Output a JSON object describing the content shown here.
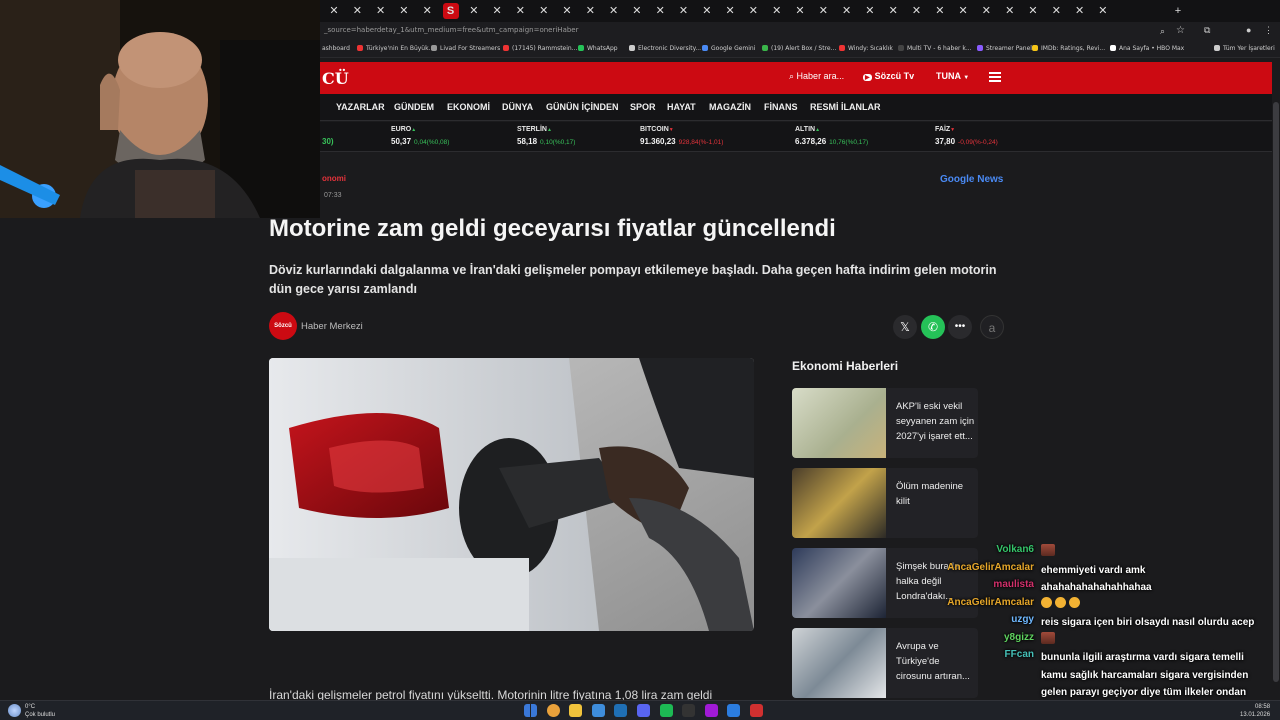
{
  "browser": {
    "url": "_source=haberdetay_1&utm_medium=free&utm_campaign=oneriHaber",
    "bookmarks": [
      "ashboard",
      "Türkiye'nin En Büyük...",
      "Livad For Streamers",
      "(17145) Rammstein...",
      "WhatsApp",
      "Electronic Diversity...",
      "Google Gemini",
      "(19) Alert Box / Stre...",
      "Windy: Sıcaklık",
      "Multi TV - 6 haber k...",
      "Streamer Panel",
      "IMDb: Ratings, Revi...",
      "Ana Sayfa • HBO Max",
      "Tüm Yer İşaretleri"
    ]
  },
  "site": {
    "logo": "CÜ",
    "search_placeholder": "Haber ara...",
    "tv_label": "Sözcü Tv",
    "user_label": "TUNA",
    "nav": [
      "YAZARLAR",
      "GÜNDEM",
      "EKONOMİ",
      "DÜNYA",
      "GÜNÜN İÇİNDEN",
      "SPOR",
      "HAYAT",
      "MAGAZİN",
      "FİNANS",
      "RESMİ İLANLAR"
    ]
  },
  "ticker": [
    {
      "name": "EURO",
      "value": "50,37",
      "change": "0,04(%0,08)",
      "dir": "up"
    },
    {
      "name": "STERLİN",
      "value": "58,18",
      "change": "0,10(%0,17)",
      "dir": "up"
    },
    {
      "name": "BITCOIN",
      "value": "91.360,23",
      "change": "928,84(%-1,01)",
      "dir": "down"
    },
    {
      "name": "ALTIN",
      "value": "6.378,26",
      "change": "10,76(%0,17)",
      "dir": "up"
    },
    {
      "name": "FAİZ",
      "value": "37,80",
      "change": "-0,09(%-0,24)",
      "dir": "down"
    }
  ],
  "ticker_partial": "30)",
  "article": {
    "category": "onomi",
    "time": "07:33",
    "google_news": "Google News",
    "headline": "Motorine zam geldi geceyarısı fiyatlar güncellendi",
    "subhead": "Döviz kurlarındaki dalgalanma ve İran'daki gelişmeler pompayı etkilemeye başladı. Daha geçen hafta indirim gelen motorin dün gece yarısı zamlandı",
    "author": "Haber Merkezi",
    "author_logo": "Sözcü",
    "body_start": "İran'daki gelişmeler petrol fiyatını yükseltti. Motorinin litre fiyatına 1,08 lira zam geldi"
  },
  "sidebar": {
    "title": "Ekonomi Haberleri",
    "items": [
      {
        "title": "AKP'li eski vekil seyyanen zam için 2027'yi işaret ett..."
      },
      {
        "title": "Ölüm madenine kilit"
      },
      {
        "title": "Şimşek burada halka değil Londra'dakı..."
      },
      {
        "title": "Avrupa ve Türkiye'de cirosunu artıran..."
      }
    ]
  },
  "chat": [
    {
      "user": "Volkan6",
      "color": "#35c46a",
      "msg": "",
      "emote": true
    },
    {
      "user": "AncaGelirAmcalar",
      "color": "#e6a72a",
      "msg": "ehemmiyeti vardı amk"
    },
    {
      "user": "maulista",
      "color": "#d2306b",
      "msg": "ahahahahahahahhahaa"
    },
    {
      "user": "AncaGelirAmcalar",
      "color": "#e6a72a",
      "msg": "",
      "faces": 3
    },
    {
      "user": "uzgy",
      "color": "#6fb8ff",
      "msg": "reis sigara içen biri olsaydı nasıl olurdu acep"
    },
    {
      "user": "y8gizz",
      "color": "#5fd35f",
      "msg": "",
      "emote": true
    },
    {
      "user": "FFcan",
      "color": "#46c0b8",
      "msg": "bununla ilgili araştırma vardı sigara temelli kamu sağlık harcamaları sigara vergisinden gelen parayı geçiyor diye tüm ilkeler ondan yasaklıyor"
    }
  ],
  "taskbar": {
    "weather_temp": "0°C",
    "weather_desc": "Çok bulutlu",
    "time": "08:58",
    "date": "13.01.2026"
  },
  "colors": {
    "brand_red": "#cc0a12",
    "up": "#38c15a",
    "down": "#e5333b"
  }
}
